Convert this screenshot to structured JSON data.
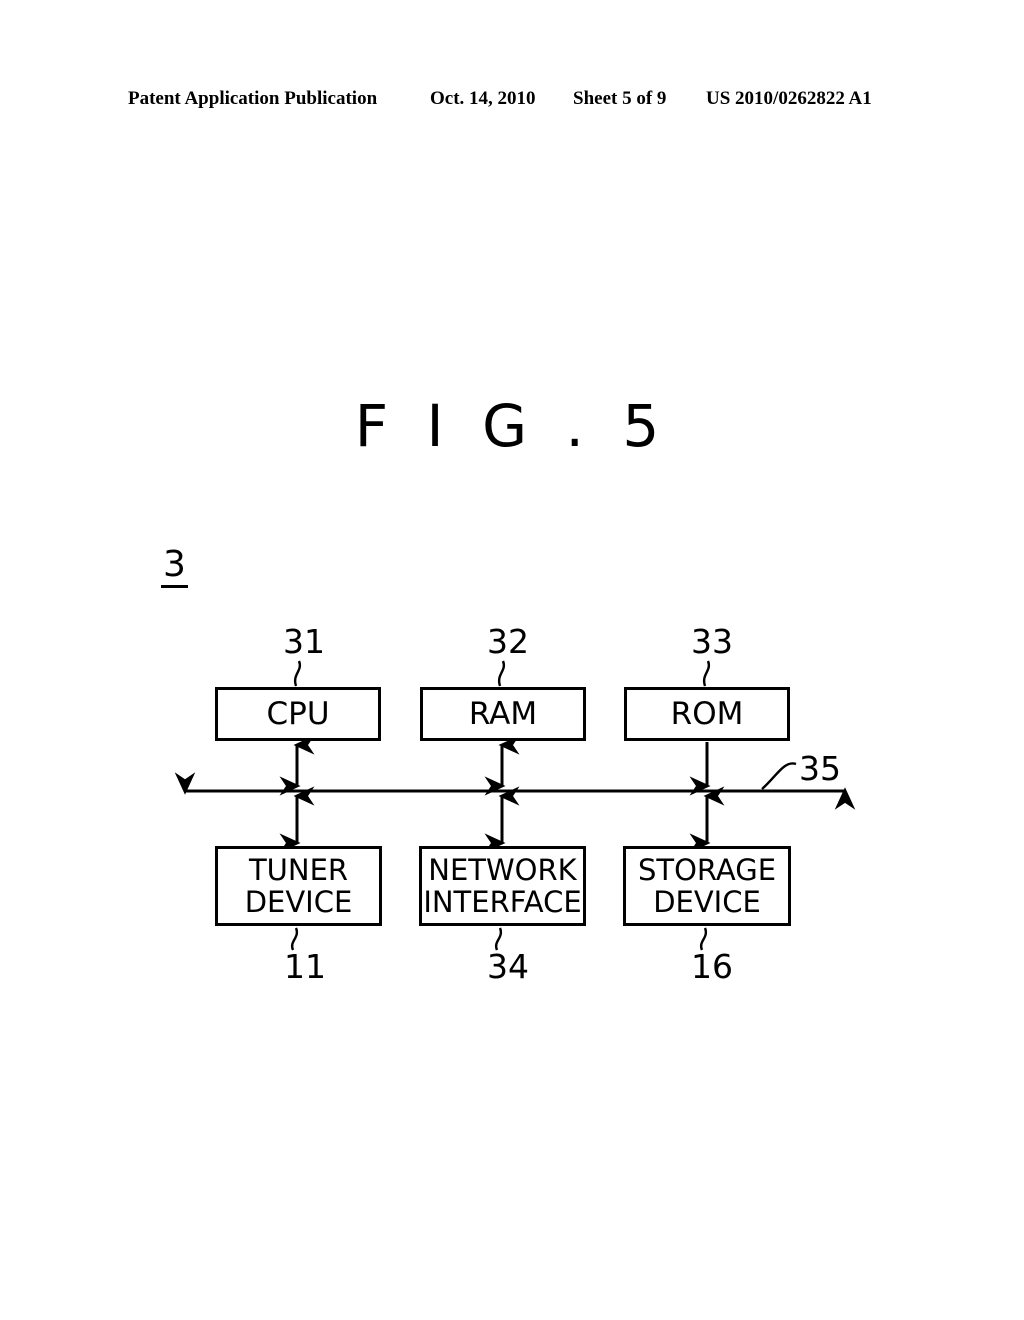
{
  "header": {
    "publication": "Patent Application Publication",
    "date": "Oct. 14, 2010",
    "sheet": "Sheet 5 of 9",
    "doc_number": "US 2010/0262822 A1"
  },
  "figure": {
    "title": "F I G . 5",
    "root_numeral": "3",
    "bus_numeral": "35"
  },
  "diagram": {
    "type": "block-diagram",
    "ink_color": "#000000",
    "background_color": "#ffffff",
    "bus": {
      "label": "35",
      "orientation": "horizontal",
      "arrowheads": "both-ends"
    },
    "nodes": [
      {
        "id": "cpu",
        "label": "CPU",
        "ref": "31",
        "ref_position": "above",
        "row": "top"
      },
      {
        "id": "ram",
        "label": "RAM",
        "ref": "32",
        "ref_position": "above",
        "row": "top"
      },
      {
        "id": "rom",
        "label": "ROM",
        "ref": "33",
        "ref_position": "above",
        "row": "top"
      },
      {
        "id": "tuner",
        "label": "TUNER\nDEVICE",
        "ref": "11",
        "ref_position": "below",
        "row": "bottom"
      },
      {
        "id": "network",
        "label": "NETWORK\nINTERFACE",
        "ref": "34",
        "ref_position": "below",
        "row": "bottom"
      },
      {
        "id": "storage",
        "label": "STORAGE\nDEVICE",
        "ref": "16",
        "ref_position": "below",
        "row": "bottom"
      }
    ],
    "connections": [
      {
        "from": "cpu",
        "to": "bus",
        "style": "double-arrow"
      },
      {
        "from": "ram",
        "to": "bus",
        "style": "double-arrow"
      },
      {
        "from": "rom",
        "to": "bus",
        "style": "double-arrow"
      },
      {
        "from": "bus",
        "to": "tuner",
        "style": "double-arrow"
      },
      {
        "from": "bus",
        "to": "network",
        "style": "double-arrow"
      },
      {
        "from": "bus",
        "to": "storage",
        "style": "double-arrow"
      }
    ]
  }
}
